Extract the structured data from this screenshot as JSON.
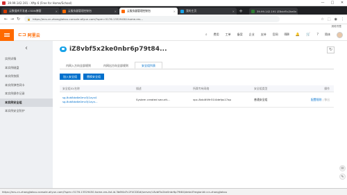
{
  "window": {
    "title": "39.99.142.191 - Xftp 6 (Free for Home/School)",
    "controls": [
      "—",
      "□",
      "✕"
    ]
  },
  "browser": {
    "tabs": [
      {
        "label": "云数据库开发者-CSDN博客",
        "favicon_color": "#d83b01",
        "active": false
      },
      {
        "label": "云服务器管理控制台",
        "favicon_color": "#ff6a00",
        "active": false
      },
      {
        "label": "云服务器管理控制台",
        "favicon_color": "#ff6a00",
        "active": true
      },
      {
        "label": "我的主页",
        "favicon_color": "#1aa3e8",
        "active": false
      },
      {
        "label": "39.99.142.191 iZ8vbf5x2ke0n",
        "favicon_color": "#2e7d32",
        "active": false
      }
    ],
    "url": "https://ecs-cn-zhangjiakou.console.aliyun.com/?spm=5176.13329450.home-res...",
    "bookmarks_right": "其他书签"
  },
  "header": {
    "logo_text": "阿里云",
    "nav": [
      "费用",
      "工单",
      "备案",
      "企业",
      "支持",
      "官网"
    ],
    "lang": "简体"
  },
  "sidebar": {
    "items": [
      {
        "label": "实例详情",
        "active": false
      },
      {
        "label": "本实例磁盘",
        "active": false
      },
      {
        "label": "本实例快照",
        "active": false
      },
      {
        "label": "本实例弹性网卡",
        "active": false
      },
      {
        "label": "本实例操作记录",
        "active": false
      },
      {
        "label": "本实例安全组",
        "active": true
      },
      {
        "label": "本实例安全防护",
        "active": false
      }
    ]
  },
  "main": {
    "instance_title": "iZ8vbf5x2ke0nbr6p79t84...",
    "subtabs": [
      {
        "label": "内网入方向全部规则",
        "active": false
      },
      {
        "label": "内网出方向全部规则",
        "active": false
      },
      {
        "label": "安全组列表",
        "active": true
      }
    ],
    "buttons": {
      "join": "加入安全组",
      "replace": "替换安全组"
    },
    "table": {
      "headers": [
        "安全组ID/名称",
        "描述",
        "所属专有网络",
        "安全组类型",
        "操作"
      ],
      "rows": [
        {
          "id": "sg-8vb8da6e0mv3j1ayx4",
          "name": "sg-8vb8da6e0mv3j1ayx...",
          "desc": "System created securit...",
          "vpc": "vpc-8vb4f49r51l4defps17ap",
          "type": "普通安全组",
          "op1": "配置规则",
          "op2": "移出"
        }
      ]
    }
  },
  "status_bar": "https://ecs-cn-zhangjiakou.console.aliyun.com/?spm=5176.13329450.home-res-list.id.3b6f4d7c2F4CDD#/server/i-8vbf5x2ke0nbr6p79t84/detail?regionId=cn-zhangjiakou"
}
